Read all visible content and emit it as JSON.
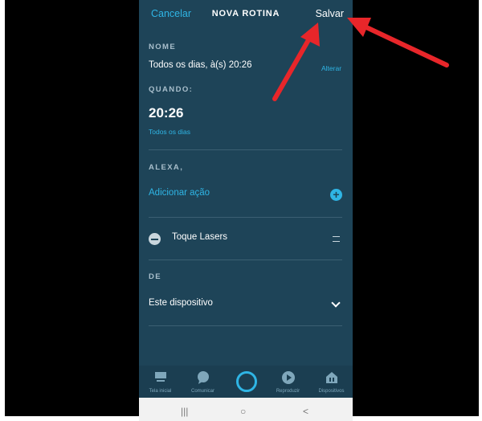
{
  "header": {
    "cancel_label": "Cancelar",
    "title": "NOVA ROTINA",
    "save_label": "Salvar"
  },
  "name_section": {
    "label": "NOME",
    "value": "Todos os dias, à(s) 20:26",
    "change_label": "Alterar"
  },
  "when_section": {
    "label": "QUANDO:",
    "time": "20:26",
    "recurrence": "Todos os dias"
  },
  "alexa_section": {
    "label": "ALEXA,",
    "add_action_label": "Adicionar ação",
    "actions": [
      {
        "name": "Toque Lasers"
      }
    ]
  },
  "from_section": {
    "label": "DE",
    "device": "Este dispositivo"
  },
  "bottom_nav": {
    "items": [
      {
        "label": "Tela inicial",
        "icon": "home-icon"
      },
      {
        "label": "Comunicar",
        "icon": "chat-bubble-icon"
      },
      {
        "label": "",
        "icon": "alexa-ring-icon"
      },
      {
        "label": "Reproduzir",
        "icon": "play-icon"
      },
      {
        "label": "Dispositivos",
        "icon": "devices-icon"
      }
    ]
  },
  "system_nav": {
    "recents_glyph": "|||",
    "home_glyph": "○",
    "back_glyph": "<"
  },
  "colors": {
    "background": "#1e4458",
    "accent": "#2fb5e5",
    "annotation_arrow": "#e8262a"
  }
}
